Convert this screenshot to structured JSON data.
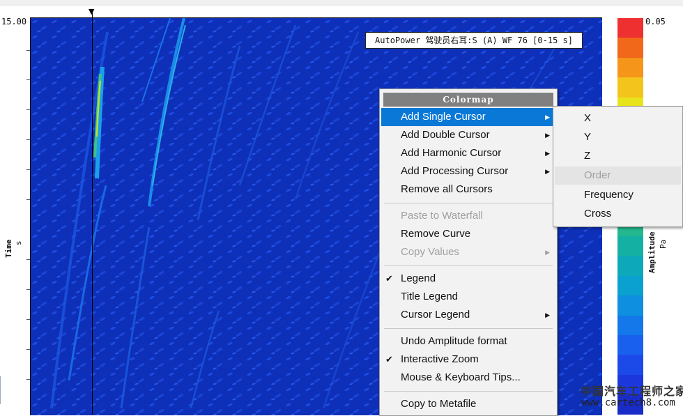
{
  "plot": {
    "y_top_value": "15.00",
    "y_axis_label": "Time",
    "y_axis_unit": "s",
    "title_legend": "AutoPower 驾驶员右耳:S (A) WF 76 [0-15 s]"
  },
  "colorbar": {
    "top_value": "0.05",
    "label": "Amplitude",
    "unit": "Pa",
    "colors": [
      "#ee3030",
      "#f2681a",
      "#f5951a",
      "#f3c41c",
      "#e8e41c",
      "#c7e82a",
      "#9ee03c",
      "#7cd84f",
      "#5ccf64",
      "#3fc37a",
      "#24b88e",
      "#14b0a4",
      "#0ea8bb",
      "#0aa0d0",
      "#0e8fe0",
      "#1478ea",
      "#1a60ee",
      "#1c4ae8",
      "#1c38dc",
      "#1a2cc8"
    ]
  },
  "context_menu": {
    "header": "Colormap",
    "items": [
      {
        "label": "Add Single Cursor",
        "submenu": true,
        "active": true
      },
      {
        "label": "Add Double Cursor",
        "submenu": true
      },
      {
        "label": "Add Harmonic Cursor",
        "submenu": true
      },
      {
        "label": "Add Processing Cursor",
        "submenu": true
      },
      {
        "label": "Remove all Cursors"
      },
      {
        "label": "Paste to Waterfall",
        "disabled": true
      },
      {
        "label": "Remove Curve"
      },
      {
        "label": "Copy Values",
        "disabled": true,
        "submenu": true
      },
      {
        "label": "Legend",
        "checked": true
      },
      {
        "label": "Title Legend"
      },
      {
        "label": "Cursor Legend",
        "submenu": true
      },
      {
        "label": "Undo Amplitude format"
      },
      {
        "label": "Interactive Zoom",
        "checked": true
      },
      {
        "label": "Mouse & Keyboard Tips..."
      },
      {
        "label": "Copy to Metafile"
      }
    ]
  },
  "submenu": {
    "items": [
      {
        "label": "X"
      },
      {
        "label": "Y"
      },
      {
        "label": "Z"
      },
      {
        "label": "Order",
        "disabled": true
      },
      {
        "label": "Frequency"
      },
      {
        "label": "Cross"
      }
    ]
  },
  "watermark": {
    "line1": "中国汽车工程师之家",
    "line2": "www.cartech8.com"
  }
}
